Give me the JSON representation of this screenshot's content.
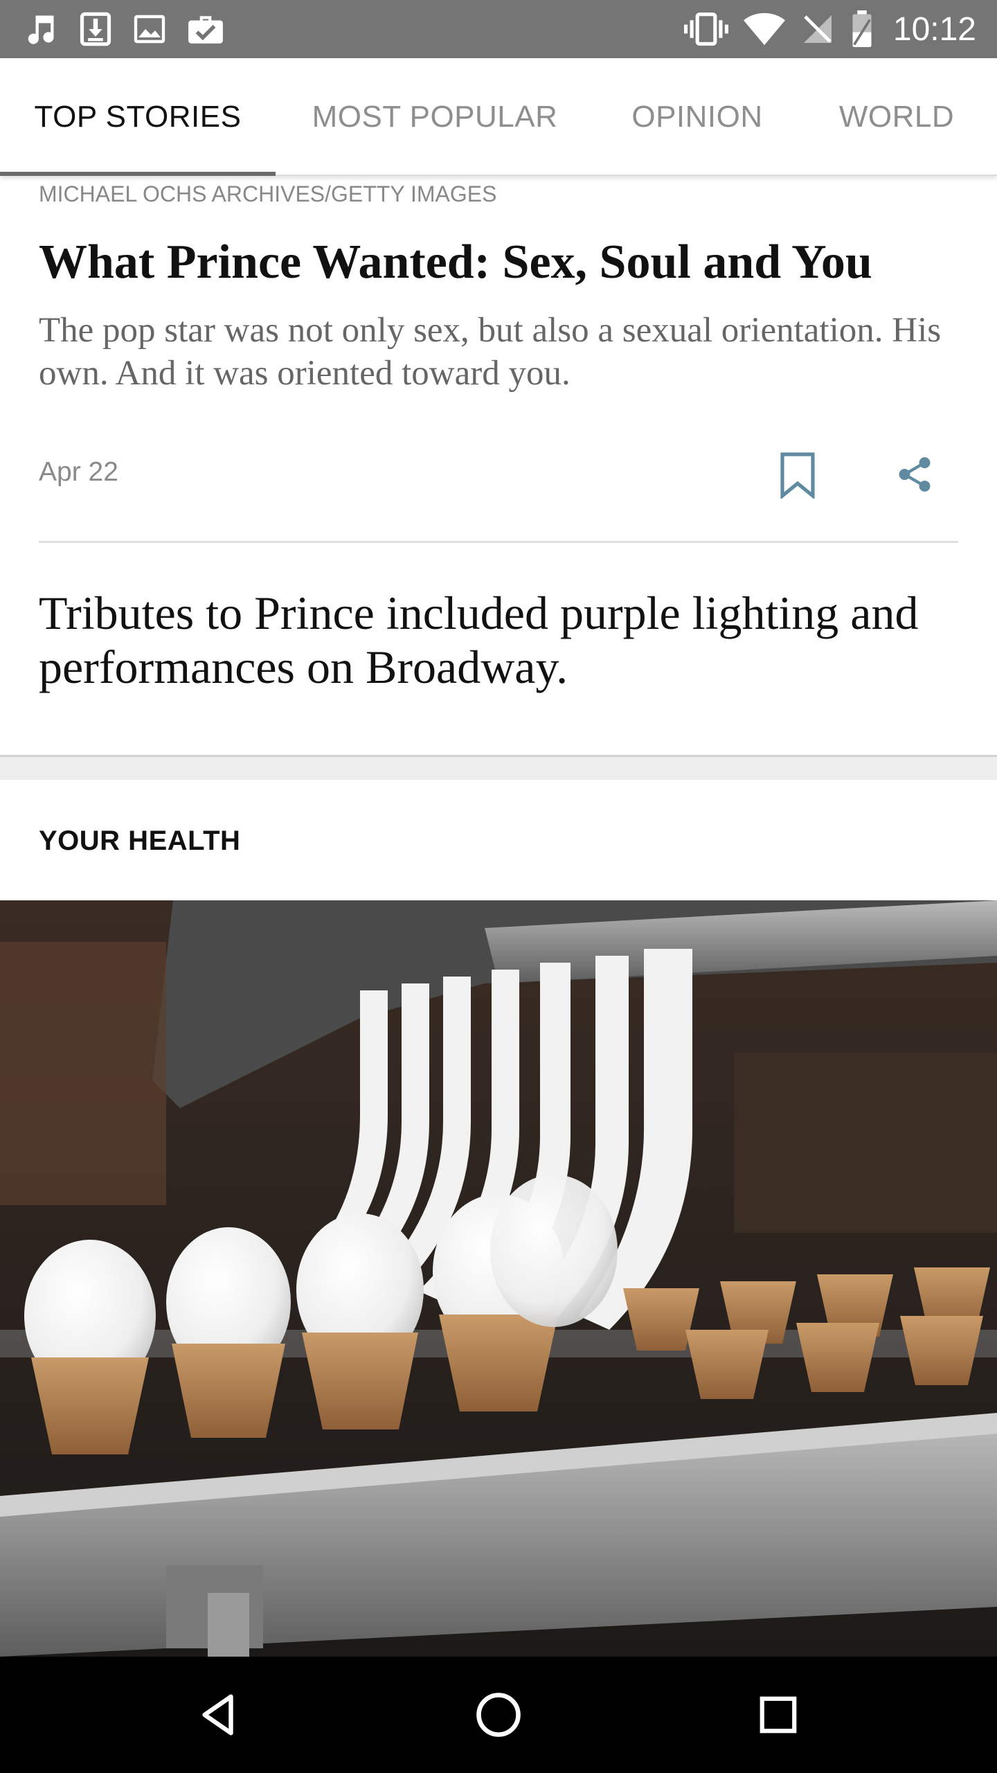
{
  "status_bar": {
    "time": "10:12",
    "left_icons": [
      "music-icon",
      "download-icon",
      "image-icon",
      "briefcase-check-icon"
    ],
    "right_icons": [
      "vibrate-icon",
      "wifi-icon",
      "no-signal-icon",
      "battery-icon"
    ]
  },
  "tabs": [
    {
      "label": "TOP STORIES",
      "active": true
    },
    {
      "label": "MOST POPULAR",
      "active": false
    },
    {
      "label": "OPINION",
      "active": false
    },
    {
      "label": "WORLD",
      "active": false
    }
  ],
  "article1": {
    "credit": "MICHAEL OCHS ARCHIVES/GETTY IMAGES",
    "headline": "What Prince Wanted: Sex, Soul and You",
    "summary": "The pop star was not only sex, but also a sexual orientation. His own. And it was oriented toward you.",
    "date": "Apr 22",
    "bookmark_icon": "bookmark-icon",
    "share_icon": "share-icon"
  },
  "article2": {
    "headline": "Tributes to Prince included purple lighting and performances on Broadway."
  },
  "section": {
    "label": "YOUR HEALTH",
    "image_description_icon": "ice-cream-cones-photo"
  },
  "nav_bar": {
    "back_icon": "back-icon",
    "home_icon": "home-icon",
    "recents_icon": "recents-icon"
  },
  "colors": {
    "status_bar": "#757575",
    "accent_icon": "#5f8aa0",
    "active_tab_text": "#111111",
    "inactive_tab_text": "#8e8e8e"
  }
}
